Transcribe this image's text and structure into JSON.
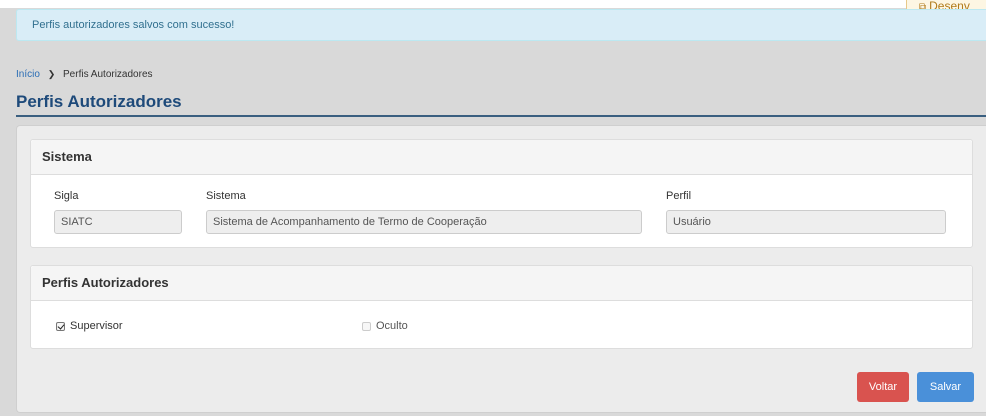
{
  "env_badge": {
    "label": "Desenv",
    "icon": "external-link-icon"
  },
  "alert": {
    "message": "Perfis autorizadores salvos com sucesso!"
  },
  "breadcrumb": {
    "home": "Início",
    "current": "Perfis Autorizadores"
  },
  "page": {
    "title": "Perfis Autorizadores"
  },
  "sistema_panel": {
    "heading": "Sistema",
    "sigla_label": "Sigla",
    "sigla_value": "SIATC",
    "sistema_label": "Sistema",
    "sistema_value": "Sistema de Acompanhamento de Termo de Cooperação",
    "perfil_label": "Perfil",
    "perfil_value": "Usuário"
  },
  "perfis_panel": {
    "heading": "Perfis Autorizadores",
    "options": [
      {
        "label": "Supervisor",
        "checked": true,
        "disabled": false
      },
      {
        "label": "Oculto",
        "checked": false,
        "disabled": true
      }
    ]
  },
  "actions": {
    "voltar": "Voltar",
    "salvar": "Salvar"
  },
  "colors": {
    "danger": "#d9534f",
    "primary": "#4a90d9",
    "title": "#1e4a7a",
    "alert_bg": "#d9edf7"
  }
}
